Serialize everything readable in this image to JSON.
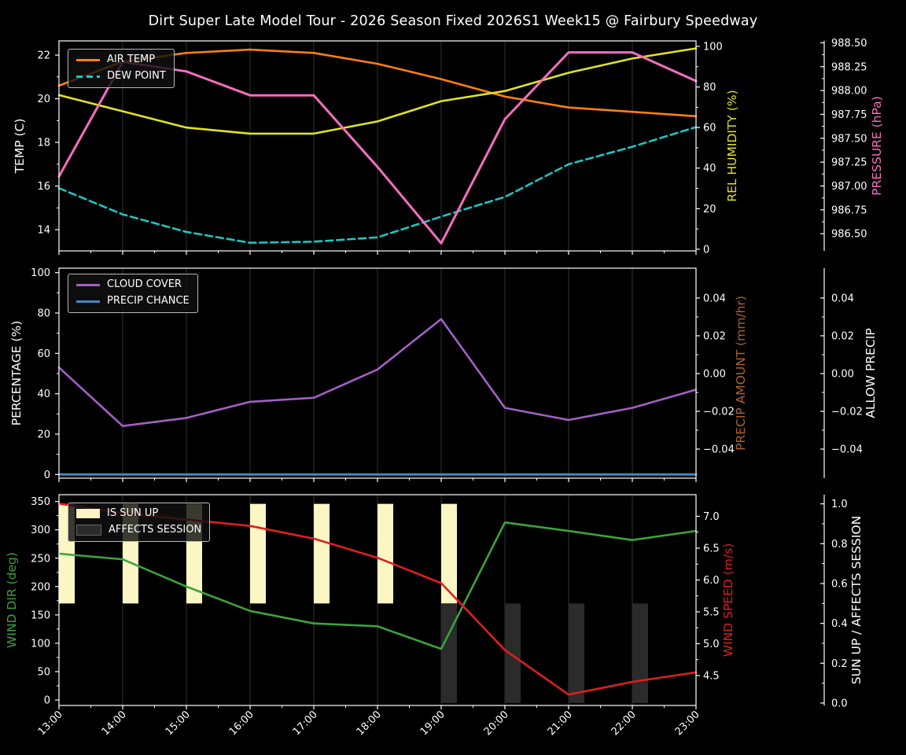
{
  "title": "Dirt Super Late Model Tour - 2026 Season Fixed 2026S1 Week15 @ Fairbury Speedway",
  "colors": {
    "foreground": "#ffffff",
    "grid": "rgba(255,255,255,0.22)",
    "air_temp": "#ff7f0e",
    "dew_point": "#1cc5c5",
    "rel_humidity": "#e3e31e",
    "pressure": "#f56ec0",
    "cloud_cover": "#a35fc5",
    "precip_chance": "#4287c5",
    "precip_amount": "#a9642f",
    "wind_dir": "#3ba33b",
    "wind_speed": "#e01e1e",
    "sun_up": "#fbf6c3",
    "affects_session": "#2b2b2b"
  },
  "x_axis": {
    "hours": [
      13,
      14,
      15,
      16,
      17,
      18,
      19,
      20,
      21,
      22,
      23
    ],
    "labels": [
      "13:00",
      "14:00",
      "15:00",
      "16:00",
      "17:00",
      "18:00",
      "19:00",
      "20:00",
      "21:00",
      "22:00",
      "23:00"
    ]
  },
  "legends": {
    "top": [
      {
        "label": "AIR TEMP",
        "swatch": "line",
        "color_key": "air_temp"
      },
      {
        "label": "DEW POINT",
        "swatch": "dashed",
        "color_key": "dew_point"
      }
    ],
    "middle": [
      {
        "label": "CLOUD COVER",
        "swatch": "line",
        "color_key": "cloud_cover"
      },
      {
        "label": "PRECIP CHANCE",
        "swatch": "line",
        "color_key": "precip_chance"
      }
    ],
    "bottom": [
      {
        "label": "IS SUN UP",
        "swatch": "patch",
        "color_key": "sun_up"
      },
      {
        "label": "AFFECTS SESSION",
        "swatch": "patch",
        "color_key": "affects_session"
      }
    ]
  },
  "chart_data": [
    {
      "id": "temperature",
      "type": "line",
      "axes": [
        {
          "side": "left",
          "label": "TEMP (C)",
          "color_key": "foreground",
          "range": [
            13.03,
            22.65
          ],
          "ticks": [
            {
              "v": 22,
              "t": "22"
            },
            {
              "v": 20,
              "t": "20"
            },
            {
              "v": 18,
              "t": "18"
            },
            {
              "v": 16,
              "t": "16"
            },
            {
              "v": 14,
              "t": "14"
            }
          ]
        },
        {
          "side": "right1",
          "label": "REL HUMIDITY (%)",
          "color_key": "rel_humidity",
          "range": [
            -0.8,
            102.7
          ],
          "ticks": [
            {
              "v": 100,
              "t": "100"
            },
            {
              "v": 80,
              "t": "80"
            },
            {
              "v": 60,
              "t": "60"
            },
            {
              "v": 40,
              "t": "40"
            },
            {
              "v": 20,
              "t": "20"
            },
            {
              "v": 0,
              "t": "0"
            }
          ]
        },
        {
          "side": "right2",
          "label": "PRESSURE (hPa)",
          "color_key": "pressure",
          "range": [
            986.32,
            988.52
          ],
          "ticks": [
            {
              "v": 988.5,
              "t": "988.50"
            },
            {
              "v": 988.25,
              "t": "988.25"
            },
            {
              "v": 988.0,
              "t": "988.00"
            },
            {
              "v": 987.75,
              "t": "987.75"
            },
            {
              "v": 987.5,
              "t": "987.50"
            },
            {
              "v": 987.25,
              "t": "987.25"
            },
            {
              "v": 987.0,
              "t": "987.00"
            },
            {
              "v": 986.75,
              "t": "986.75"
            },
            {
              "v": 986.5,
              "t": "986.50"
            }
          ]
        }
      ],
      "series": [
        {
          "name": "AIR TEMP",
          "axis": 0,
          "color_key": "air_temp",
          "lw": 2.6,
          "dash": null,
          "values": [
            20.6,
            21.7,
            22.1,
            22.25,
            22.1,
            21.6,
            20.9,
            20.1,
            19.6,
            19.4,
            19.2
          ]
        },
        {
          "name": "DEW POINT",
          "axis": 0,
          "color_key": "dew_point",
          "lw": 2.6,
          "dash": "9 5",
          "values": [
            15.9,
            14.7,
            13.9,
            13.4,
            13.45,
            13.65,
            14.6,
            15.5,
            17.0,
            17.8,
            18.7
          ]
        },
        {
          "name": "REL HUMIDITY",
          "axis": 1,
          "color_key": "rel_humidity",
          "lw": 2.6,
          "dash": null,
          "values": [
            76,
            68,
            60,
            57,
            57,
            63,
            73,
            78,
            87,
            94,
            99
          ]
        },
        {
          "name": "PRESSURE",
          "axis": 2,
          "color_key": "pressure",
          "lw": 3,
          "dash": null,
          "values": [
            987.1,
            988.3,
            988.2,
            987.95,
            987.95,
            987.2,
            986.4,
            987.7,
            988.4,
            988.4,
            988.1
          ]
        }
      ]
    },
    {
      "id": "precipitation",
      "type": "line",
      "axes": [
        {
          "side": "left",
          "label": "PERCENTAGE (%)",
          "color_key": "foreground",
          "range": [
            -1.83,
            102.2
          ],
          "ticks": [
            {
              "v": 100,
              "t": "100"
            },
            {
              "v": 80,
              "t": "80"
            },
            {
              "v": 60,
              "t": "60"
            },
            {
              "v": 40,
              "t": "40"
            },
            {
              "v": 20,
              "t": "20"
            },
            {
              "v": 0,
              "t": "0"
            }
          ]
        },
        {
          "side": "right1",
          "label": "PRECIP AMOUNT (mm/hr)",
          "color_key": "precip_amount",
          "range": [
            -0.0554,
            0.0558
          ],
          "ticks": [
            {
              "v": 0.04,
              "t": "0.04"
            },
            {
              "v": 0.02,
              "t": "0.02"
            },
            {
              "v": 0,
              "t": "0.00"
            },
            {
              "v": -0.02,
              "t": "−0.02"
            },
            {
              "v": -0.04,
              "t": "−0.04"
            }
          ]
        },
        {
          "side": "right2",
          "label": "ALLOW PRECIP",
          "color_key": "foreground",
          "range": [
            -0.0554,
            0.0558
          ],
          "ticks": [
            {
              "v": 0.04,
              "t": "0.04"
            },
            {
              "v": 0.02,
              "t": "0.02"
            },
            {
              "v": 0,
              "t": "0.00"
            },
            {
              "v": -0.02,
              "t": "−0.02"
            },
            {
              "v": -0.04,
              "t": "−0.04"
            }
          ]
        }
      ],
      "series": [
        {
          "name": "CLOUD COVER",
          "axis": 0,
          "color_key": "cloud_cover",
          "lw": 2.6,
          "dash": null,
          "values": [
            53,
            24,
            28,
            36,
            38,
            52,
            77,
            33,
            27,
            33,
            42
          ]
        },
        {
          "name": "PRECIP CHANCE",
          "axis": 0,
          "color_key": "precip_chance",
          "lw": 3,
          "dash": null,
          "values": [
            0,
            0,
            0,
            0,
            0,
            0,
            0,
            0,
            0,
            0,
            0
          ]
        }
      ]
    },
    {
      "id": "wind",
      "type": "line-bar",
      "axes": [
        {
          "side": "left",
          "label": "WIND DIR (deg)",
          "color_key": "wind_dir",
          "range": [
            -9.7,
            362.0
          ],
          "ticks": [
            {
              "v": 350,
              "t": "350"
            },
            {
              "v": 300,
              "t": "300"
            },
            {
              "v": 250,
              "t": "250"
            },
            {
              "v": 200,
              "t": "200"
            },
            {
              "v": 150,
              "t": "150"
            },
            {
              "v": 100,
              "t": "100"
            },
            {
              "v": 50,
              "t": "50"
            },
            {
              "v": 0,
              "t": "0"
            }
          ]
        },
        {
          "side": "right1",
          "label": "WIND SPEED (m/s)",
          "color_key": "wind_speed",
          "range": [
            4.03,
            7.34
          ],
          "ticks": [
            {
              "v": 7.0,
              "t": "7.0"
            },
            {
              "v": 6.5,
              "t": "6.5"
            },
            {
              "v": 6.0,
              "t": "6.0"
            },
            {
              "v": 5.5,
              "t": "5.5"
            },
            {
              "v": 5.0,
              "t": "5.0"
            },
            {
              "v": 4.5,
              "t": "4.5"
            }
          ]
        },
        {
          "side": "right2",
          "label": "SUN UP / AFFECTS SESSION",
          "color_key": "foreground",
          "range": [
            -0.012,
            1.046
          ],
          "ticks": [
            {
              "v": 1.0,
              "t": "1.0"
            },
            {
              "v": 0.8,
              "t": "0.8"
            },
            {
              "v": 0.6,
              "t": "0.6"
            },
            {
              "v": 0.4,
              "t": "0.4"
            },
            {
              "v": 0.2,
              "t": "0.2"
            },
            {
              "v": 0.0,
              "t": "0.0"
            }
          ]
        }
      ],
      "series": [
        {
          "name": "WIND DIR",
          "axis": 0,
          "color_key": "wind_dir",
          "lw": 2.6,
          "dash": null,
          "values": [
            258,
            248,
            200,
            157,
            135,
            130,
            90,
            313,
            298,
            282,
            298
          ]
        },
        {
          "name": "WIND SPEED",
          "axis": 1,
          "color_key": "wind_speed",
          "lw": 2.6,
          "dash": null,
          "values": [
            7.2,
            7.05,
            6.95,
            6.85,
            6.65,
            6.35,
            5.95,
            4.9,
            4.2,
            4.4,
            4.55
          ]
        }
      ],
      "bars": [
        {
          "name": "IS SUN UP",
          "axis": 2,
          "color_key": "sun_up",
          "from": 0.5,
          "to": 1.0,
          "hours": [
            13,
            14,
            15,
            16,
            17,
            18,
            19
          ]
        },
        {
          "name": "AFFECTS SESSION",
          "axis": 2,
          "color_key": "affects_session",
          "from": 0.0,
          "to": 0.5,
          "hours": [
            19,
            20,
            21,
            22
          ]
        }
      ]
    }
  ]
}
